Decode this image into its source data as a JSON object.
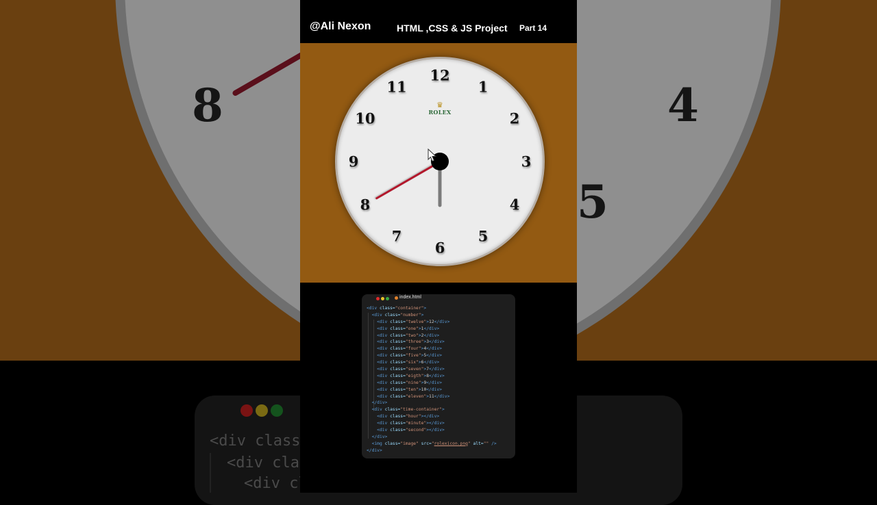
{
  "header": {
    "handle": "@Ali Nexon",
    "project": "HTML ,CSS & JS Project",
    "part": "Part 14"
  },
  "clock": {
    "numbers": [
      {
        "label": "12",
        "angle": 0
      },
      {
        "label": "1",
        "angle": 30
      },
      {
        "label": "2",
        "angle": 60
      },
      {
        "label": "3",
        "angle": 90
      },
      {
        "label": "4",
        "angle": 120
      },
      {
        "label": "5",
        "angle": 150
      },
      {
        "label": "6",
        "angle": 180
      },
      {
        "label": "7",
        "angle": 210
      },
      {
        "label": "8",
        "angle": 240
      },
      {
        "label": "9",
        "angle": 270
      },
      {
        "label": "10",
        "angle": 300
      },
      {
        "label": "11",
        "angle": 330
      }
    ],
    "logo": "ROLEX",
    "minute_hand_deg": 180,
    "second_hand_deg": 240,
    "face_color": "#ececec",
    "background_color": "#935a12",
    "second_hand_color": "#b3172b"
  },
  "code": {
    "filename": "index.html",
    "window_dots": [
      "#e02b2b",
      "#e7c32a",
      "#36a840"
    ],
    "lines": [
      [
        {
          "c": "t",
          "v": "<div "
        },
        {
          "c": "a",
          "v": "class="
        },
        {
          "c": "s",
          "v": "\"container\""
        },
        {
          "c": "t",
          "v": ">"
        }
      ],
      [
        {
          "c": "p",
          "v": "  "
        },
        {
          "c": "t",
          "v": "<div "
        },
        {
          "c": "a",
          "v": "class="
        },
        {
          "c": "s",
          "v": "\"number\""
        },
        {
          "c": "t",
          "v": ">"
        }
      ],
      [
        {
          "c": "p",
          "v": "    "
        },
        {
          "c": "t",
          "v": "<div "
        },
        {
          "c": "a",
          "v": "class="
        },
        {
          "c": "s",
          "v": "\"twelve\""
        },
        {
          "c": "t",
          "v": ">"
        },
        {
          "c": "p",
          "v": "12"
        },
        {
          "c": "t",
          "v": "</div>"
        }
      ],
      [
        {
          "c": "p",
          "v": "    "
        },
        {
          "c": "t",
          "v": "<div "
        },
        {
          "c": "a",
          "v": "class="
        },
        {
          "c": "s",
          "v": "\"one\""
        },
        {
          "c": "t",
          "v": ">"
        },
        {
          "c": "p",
          "v": "1"
        },
        {
          "c": "t",
          "v": "</div>"
        }
      ],
      [
        {
          "c": "p",
          "v": "    "
        },
        {
          "c": "t",
          "v": "<div "
        },
        {
          "c": "a",
          "v": "class="
        },
        {
          "c": "s",
          "v": "\"two\""
        },
        {
          "c": "t",
          "v": ">"
        },
        {
          "c": "p",
          "v": "2"
        },
        {
          "c": "t",
          "v": "</div>"
        }
      ],
      [
        {
          "c": "p",
          "v": "    "
        },
        {
          "c": "t",
          "v": "<div "
        },
        {
          "c": "a",
          "v": "class="
        },
        {
          "c": "s",
          "v": "\"three\""
        },
        {
          "c": "t",
          "v": ">"
        },
        {
          "c": "p",
          "v": "3"
        },
        {
          "c": "t",
          "v": "</div>"
        }
      ],
      [
        {
          "c": "p",
          "v": "    "
        },
        {
          "c": "t",
          "v": "<div "
        },
        {
          "c": "a",
          "v": "class="
        },
        {
          "c": "s",
          "v": "\"four\""
        },
        {
          "c": "t",
          "v": ">"
        },
        {
          "c": "p",
          "v": "4"
        },
        {
          "c": "t",
          "v": "</div>"
        }
      ],
      [
        {
          "c": "p",
          "v": "    "
        },
        {
          "c": "t",
          "v": "<div "
        },
        {
          "c": "a",
          "v": "class="
        },
        {
          "c": "s",
          "v": "\"five\""
        },
        {
          "c": "t",
          "v": ">"
        },
        {
          "c": "p",
          "v": "5"
        },
        {
          "c": "t",
          "v": "</div>"
        }
      ],
      [
        {
          "c": "p",
          "v": "    "
        },
        {
          "c": "t",
          "v": "<div "
        },
        {
          "c": "a",
          "v": "class="
        },
        {
          "c": "s",
          "v": "\"six\""
        },
        {
          "c": "t",
          "v": ">"
        },
        {
          "c": "p",
          "v": "6"
        },
        {
          "c": "t",
          "v": "</div>"
        }
      ],
      [
        {
          "c": "p",
          "v": "    "
        },
        {
          "c": "t",
          "v": "<div "
        },
        {
          "c": "a",
          "v": "class="
        },
        {
          "c": "s",
          "v": "\"seven\""
        },
        {
          "c": "t",
          "v": ">"
        },
        {
          "c": "p",
          "v": "7"
        },
        {
          "c": "t",
          "v": "</div>"
        }
      ],
      [
        {
          "c": "p",
          "v": "    "
        },
        {
          "c": "t",
          "v": "<div "
        },
        {
          "c": "a",
          "v": "class="
        },
        {
          "c": "s",
          "v": "\"eigth\""
        },
        {
          "c": "t",
          "v": ">"
        },
        {
          "c": "p",
          "v": "8"
        },
        {
          "c": "t",
          "v": "</div>"
        }
      ],
      [
        {
          "c": "p",
          "v": "    "
        },
        {
          "c": "t",
          "v": "<div "
        },
        {
          "c": "a",
          "v": "class="
        },
        {
          "c": "s",
          "v": "\"nine\""
        },
        {
          "c": "t",
          "v": ">"
        },
        {
          "c": "p",
          "v": "9"
        },
        {
          "c": "t",
          "v": "</div>"
        }
      ],
      [
        {
          "c": "p",
          "v": "    "
        },
        {
          "c": "t",
          "v": "<div "
        },
        {
          "c": "a",
          "v": "class="
        },
        {
          "c": "s",
          "v": "\"ten\""
        },
        {
          "c": "t",
          "v": ">"
        },
        {
          "c": "p",
          "v": "10"
        },
        {
          "c": "t",
          "v": "</div>"
        }
      ],
      [
        {
          "c": "p",
          "v": "    "
        },
        {
          "c": "t",
          "v": "<div "
        },
        {
          "c": "a",
          "v": "class="
        },
        {
          "c": "s",
          "v": "\"eleven\""
        },
        {
          "c": "t",
          "v": ">"
        },
        {
          "c": "p",
          "v": "11"
        },
        {
          "c": "t",
          "v": "</div>"
        }
      ],
      [
        {
          "c": "p",
          "v": "  "
        },
        {
          "c": "t",
          "v": "</div>"
        }
      ],
      [
        {
          "c": "p",
          "v": "  "
        },
        {
          "c": "t",
          "v": "<div "
        },
        {
          "c": "a",
          "v": "class="
        },
        {
          "c": "s",
          "v": "\"time-container\""
        },
        {
          "c": "t",
          "v": ">"
        }
      ],
      [
        {
          "c": "p",
          "v": "    "
        },
        {
          "c": "t",
          "v": "<div "
        },
        {
          "c": "a",
          "v": "class="
        },
        {
          "c": "s",
          "v": "\"hour\""
        },
        {
          "c": "t",
          "v": "></div>"
        }
      ],
      [
        {
          "c": "p",
          "v": "    "
        },
        {
          "c": "t",
          "v": "<div "
        },
        {
          "c": "a",
          "v": "class="
        },
        {
          "c": "s",
          "v": "\"minute\""
        },
        {
          "c": "t",
          "v": "></div>"
        }
      ],
      [
        {
          "c": "p",
          "v": "    "
        },
        {
          "c": "t",
          "v": "<div "
        },
        {
          "c": "a",
          "v": "class="
        },
        {
          "c": "s",
          "v": "\"second\""
        },
        {
          "c": "t",
          "v": "></div>"
        }
      ],
      [
        {
          "c": "p",
          "v": "  "
        },
        {
          "c": "t",
          "v": "</div>"
        }
      ],
      [
        {
          "c": "p",
          "v": "  "
        },
        {
          "c": "t",
          "v": "<img "
        },
        {
          "c": "a",
          "v": "class="
        },
        {
          "c": "s",
          "v": "\"image\""
        },
        {
          "c": "a",
          "v": " src="
        },
        {
          "c": "s",
          "v": "\""
        },
        {
          "c": "s u",
          "v": "rolexicon.png"
        },
        {
          "c": "s",
          "v": "\""
        },
        {
          "c": "a",
          "v": " alt="
        },
        {
          "c": "s",
          "v": "\"\""
        },
        {
          "c": "t",
          "v": " />"
        }
      ],
      [
        {
          "c": "t",
          "v": "</div>"
        }
      ]
    ]
  },
  "background": {
    "numbers": [
      "8",
      "4",
      "5"
    ],
    "code_snippets": [
      "<div class=",
      "<div clas",
      "<div cl"
    ]
  }
}
